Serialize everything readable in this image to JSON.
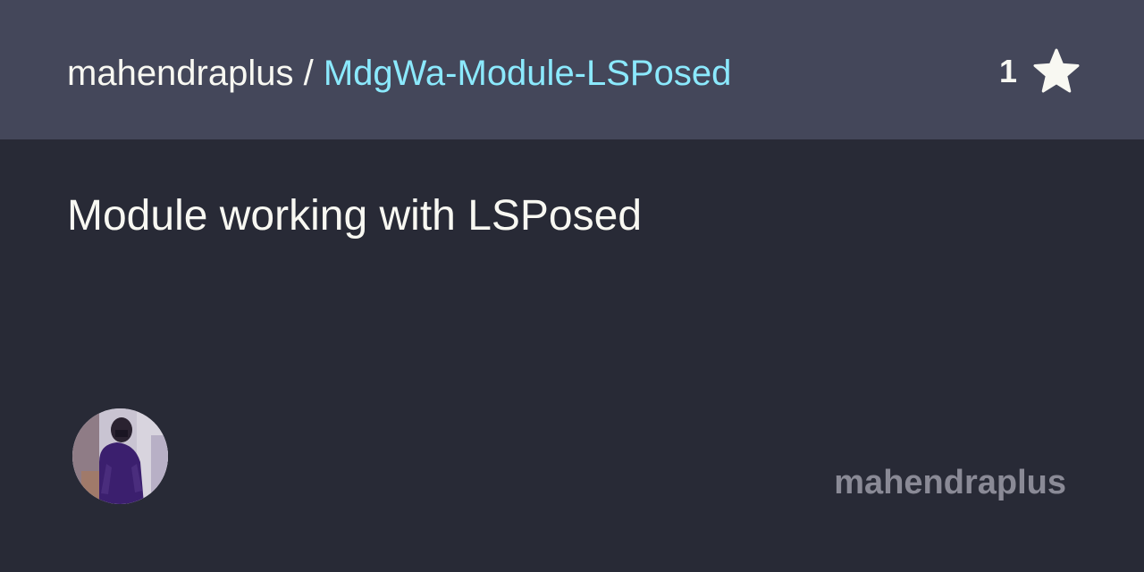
{
  "header": {
    "owner": "mahendraplus",
    "separator": " / ",
    "repo": "MdgWa-Module-LSPosed",
    "star_count": "1",
    "star_icon": "star-icon"
  },
  "description": "Module working with LSPosed",
  "footer": {
    "avatar_icon": "avatar",
    "username": "mahendraplus"
  },
  "colors": {
    "background": "#282a36",
    "header_background": "#44475a",
    "text": "#f8f8f2",
    "repo_accent": "#8be9fd",
    "username": "#8a8a96"
  }
}
